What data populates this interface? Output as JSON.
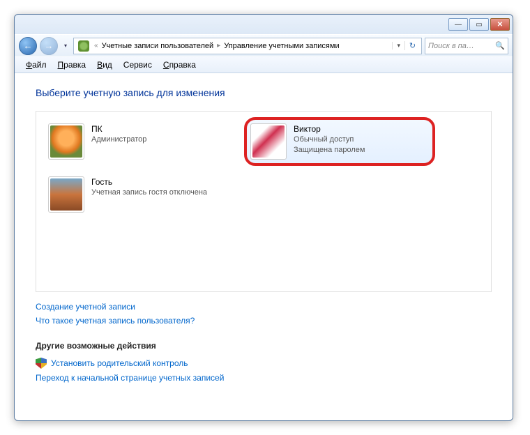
{
  "titlebar": {
    "min": "—",
    "max": "▭",
    "close": "✕"
  },
  "nav": {
    "back_glyph": "←",
    "fwd_glyph": "→",
    "drop": "▾",
    "refresh": "↻",
    "addr_drop": "▾"
  },
  "breadcrumb": {
    "prefix": "«",
    "seg1": "Учетные записи пользователей",
    "seg2": "Управление учетными записями"
  },
  "search": {
    "placeholder": "Поиск в па…",
    "icon": "🔍"
  },
  "menu": {
    "file": "Файл",
    "edit": "Правка",
    "view": "Вид",
    "tools": "Сервис",
    "help": "Справка",
    "file_u": "Ф",
    "edit_u": "П",
    "view_u": "В",
    "tools_u": "е",
    "help_u": "С"
  },
  "heading": "Выберите учетную запись для изменения",
  "accounts": [
    {
      "name": "ПК",
      "line1": "Администратор",
      "line2": ""
    },
    {
      "name": "Виктор",
      "line1": "Обычный доступ",
      "line2": "Защищена паролем"
    },
    {
      "name": "Гость",
      "line1": "Учетная запись гостя отключена",
      "line2": ""
    }
  ],
  "links": {
    "create": "Создание учетной записи",
    "what": "Что такое учетная запись пользователя?"
  },
  "other": {
    "heading": "Другие возможные действия",
    "parental": "Установить родительский контроль",
    "goto": "Переход к начальной странице учетных записей"
  }
}
